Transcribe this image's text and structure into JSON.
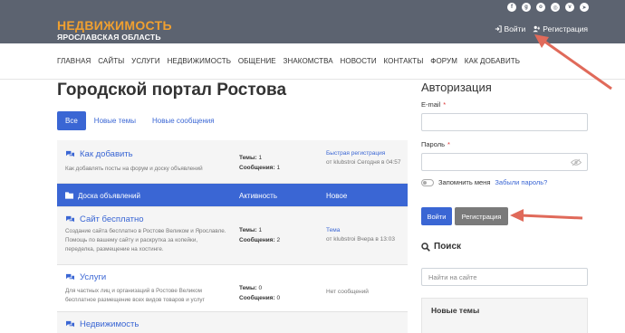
{
  "header": {
    "logo_main": "НЕДВИЖИМОСТЬ",
    "logo_sub": "ЯРОСЛАВСКАЯ ОБЛАСТЬ",
    "social_icons": [
      "facebook-icon",
      "github-icon",
      "odnoklassniki-icon",
      "instagram-icon",
      "vk-icon",
      "telegram-icon"
    ],
    "login_label": "Войти",
    "register_label": "Регистрация"
  },
  "nav": {
    "items": [
      "ГЛАВНАЯ",
      "САЙТЫ",
      "УСЛУГИ",
      "НЕДВИЖИМОСТЬ",
      "ОБЩЕНИЕ",
      "ЗНАКОМСТВА",
      "НОВОСТИ",
      "КОНТАКТЫ",
      "ФОРУМ",
      "КАК ДОБАВИТЬ"
    ]
  },
  "main": {
    "title": "Городской портал Ростова",
    "tabs": [
      "Все",
      "Новые темы",
      "Новые сообщения"
    ],
    "forums": [
      {
        "title": "Как добавить",
        "desc": "Как добавлять посты на форум и доску объявлений",
        "topics_label": "Темы:",
        "topics": "1",
        "posts_label": "Сообщения:",
        "posts": "1",
        "last_title": "Быстрая регистрация",
        "last_meta": "от klubstroi Сегодня в 04:57"
      },
      {
        "category": "Доска объявлений",
        "col_activity": "Активность",
        "col_new": "Новое"
      },
      {
        "title": "Сайт бесплатно",
        "desc": "Создание сайта бесплатно в Ростове Великом и Ярославле. Помощь по вашему сайту и раскрутка за копейки, переделка, размещение на хостинге.",
        "topics_label": "Темы:",
        "topics": "1",
        "posts_label": "Сообщения:",
        "posts": "2",
        "last_title": "Тема",
        "last_meta": "от klubstroi Вчера в 13:03"
      },
      {
        "title": "Услуги",
        "desc": "Для частных лиц и организаций в Ростове Великом бесплатное размещение всех видов товаров и услуг",
        "topics_label": "Темы:",
        "topics": "0",
        "posts_label": "Сообщения:",
        "posts": "0",
        "last_title": "",
        "last_meta": "Нет сообщений"
      },
      {
        "title": "Недвижимость"
      }
    ]
  },
  "sidebar": {
    "auth_title": "Авторизация",
    "email_label": "E-mail",
    "password_label": "Пароль",
    "required_mark": "*",
    "remember_label": "Запомнить меня",
    "forgot_label": "Забыли пароль?",
    "login_button": "Войти",
    "register_button": "Регистрация",
    "search_title": "Поиск",
    "search_placeholder": "Найти на сайте",
    "new_topics_title": "Новые темы"
  },
  "colors": {
    "topbar": "#5c6370",
    "accent": "#3a66d4",
    "logo": "#f0a030",
    "arrow": "#e06a5a"
  }
}
